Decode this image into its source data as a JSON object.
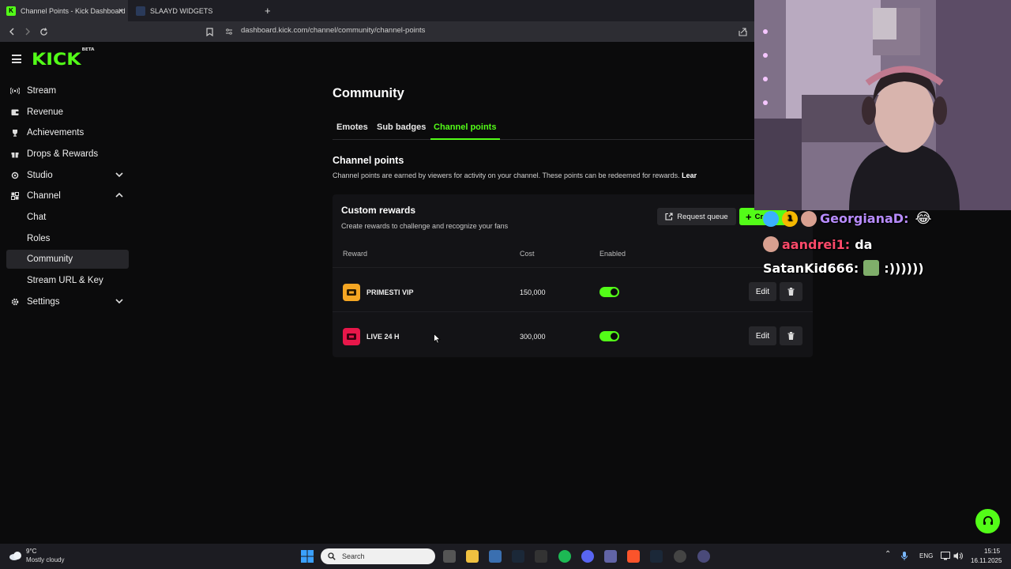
{
  "browser": {
    "tabs": [
      {
        "title": "Channel Points - Kick Dashboard",
        "active": true
      },
      {
        "title": "SLAAYD WIDGETS",
        "active": false
      }
    ],
    "new_tab": "+",
    "url": "dashboard.kick.com/channel/community/channel-points"
  },
  "sidebar": {
    "logo": "KICK",
    "logo_badge": "BETA",
    "items": [
      {
        "label": "Stream",
        "icon": "broadcast-icon"
      },
      {
        "label": "Revenue",
        "icon": "wallet-icon"
      },
      {
        "label": "Achievements",
        "icon": "trophy-icon"
      },
      {
        "label": "Drops & Rewards",
        "icon": "gift-icon"
      },
      {
        "label": "Studio",
        "icon": "studio-icon",
        "expandable": true,
        "expanded": false
      },
      {
        "label": "Channel",
        "icon": "channel-icon",
        "expandable": true,
        "expanded": true
      },
      {
        "label": "Chat",
        "sub": true
      },
      {
        "label": "Roles",
        "sub": true
      },
      {
        "label": "Community",
        "sub": true,
        "active": true
      },
      {
        "label": "Stream URL & Key",
        "sub": true
      },
      {
        "label": "Settings",
        "icon": "gear-icon",
        "expandable": true,
        "expanded": false
      }
    ]
  },
  "main": {
    "title": "Community",
    "tabs": [
      {
        "label": "Emotes"
      },
      {
        "label": "Sub badges"
      },
      {
        "label": "Channel points",
        "active": true
      }
    ],
    "section_title": "Channel points",
    "section_desc": "Channel points are earned by viewers for activity on your channel. These points can be redeemed for rewards.",
    "section_link": "Lear",
    "card": {
      "title": "Custom rewards",
      "subtitle": "Create rewards to challenge and recognize your fans",
      "queue_button": "Request queue",
      "create_button": "Cr",
      "columns": [
        "Reward",
        "Cost",
        "Enabled"
      ],
      "rows": [
        {
          "name": "PRIMESTI VIP",
          "cost": "150,000",
          "enabled": true,
          "icon_color": "#f5a623",
          "edit": "Edit"
        },
        {
          "name": "LIVE 24 H",
          "cost": "300,000",
          "enabled": true,
          "icon_color": "#e8174a",
          "edit": "Edit"
        }
      ]
    }
  },
  "overlay_chat": [
    {
      "user": "GeorgianaD:",
      "message": "",
      "color": "#b88cff",
      "badge_text": "1"
    },
    {
      "user": "aandrei1:",
      "message": "da",
      "color": "#ff4a6a"
    },
    {
      "user": "SatanKid666:",
      "message": ":))))))",
      "color": "#ffffff"
    }
  ],
  "taskbar": {
    "weather_temp": "9°C",
    "weather_desc": "Mostly cloudy",
    "search_placeholder": "Search",
    "lang": "ENG",
    "time": "15:15",
    "date": "16.11.2025"
  },
  "colors": {
    "accent": "#53fc18",
    "background": "#0b0b0c"
  }
}
